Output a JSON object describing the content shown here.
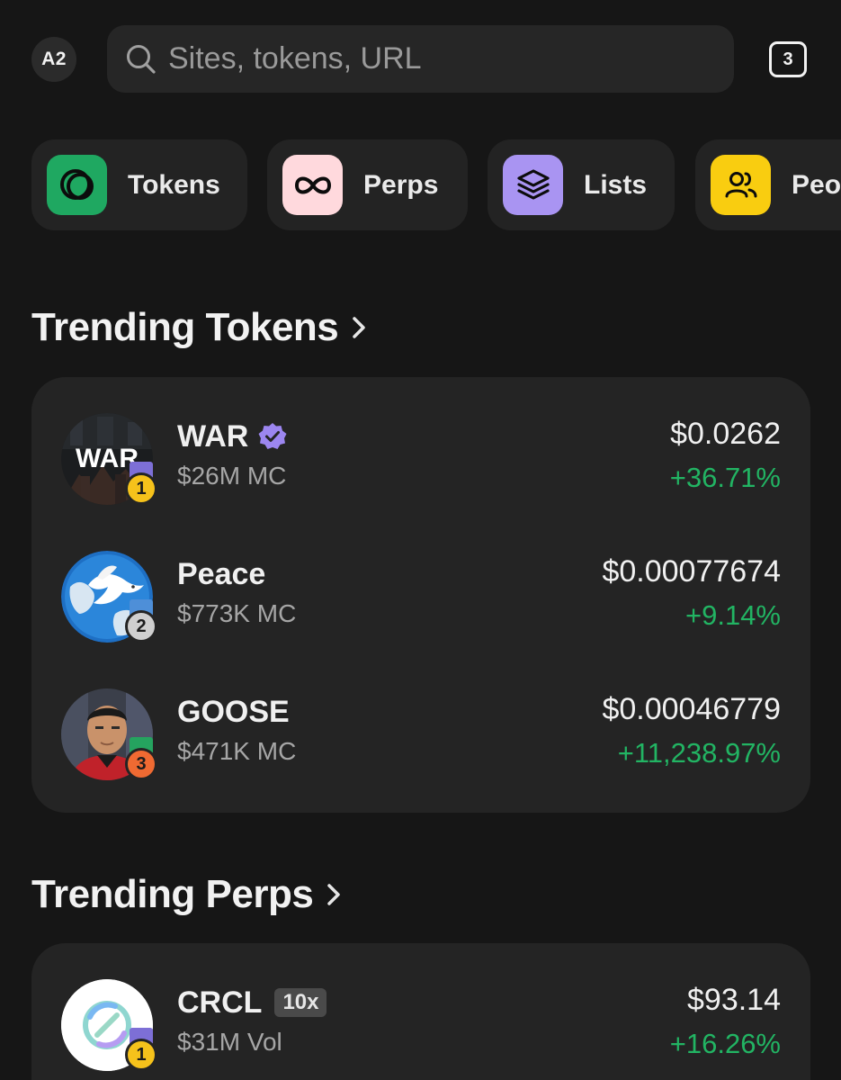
{
  "header": {
    "account_badge": "A2",
    "search_placeholder": "Sites, tokens, URL",
    "tab_count": "3"
  },
  "categories": [
    {
      "label": "Tokens",
      "icon": "tokens-icon",
      "color": "#1fa861"
    },
    {
      "label": "Perps",
      "icon": "infinity-icon",
      "color": "#ffd9dd"
    },
    {
      "label": "Lists",
      "icon": "layers-icon",
      "color": "#a994f2"
    },
    {
      "label": "People",
      "icon": "people-icon",
      "color": "#f9cd10"
    }
  ],
  "trending_tokens": {
    "title": "Trending Tokens",
    "items": [
      {
        "name": "WAR",
        "verified": true,
        "market_cap": "$26M MC",
        "price": "$0.0262",
        "change": "+36.71%",
        "rank": "1",
        "logo_text": "WAR"
      },
      {
        "name": "Peace",
        "verified": false,
        "market_cap": "$773K MC",
        "price": "$0.00077674",
        "change": "+9.14%",
        "rank": "2"
      },
      {
        "name": "GOOSE",
        "verified": false,
        "market_cap": "$471K MC",
        "price": "$0.00046779",
        "change": "+11,238.97%",
        "rank": "3"
      }
    ]
  },
  "trending_perps": {
    "title": "Trending Perps",
    "items": [
      {
        "name": "CRCL",
        "leverage": "10x",
        "volume": "$31M Vol",
        "price": "$93.14",
        "change": "+16.26%",
        "rank": "1"
      }
    ]
  },
  "colors": {
    "background": "#161616",
    "card": "#242424",
    "positive": "#22b463",
    "verified": "#9c86f0",
    "gold": "#f6c21b",
    "silver": "#cfcfcf",
    "bronze": "#ef6a32"
  }
}
